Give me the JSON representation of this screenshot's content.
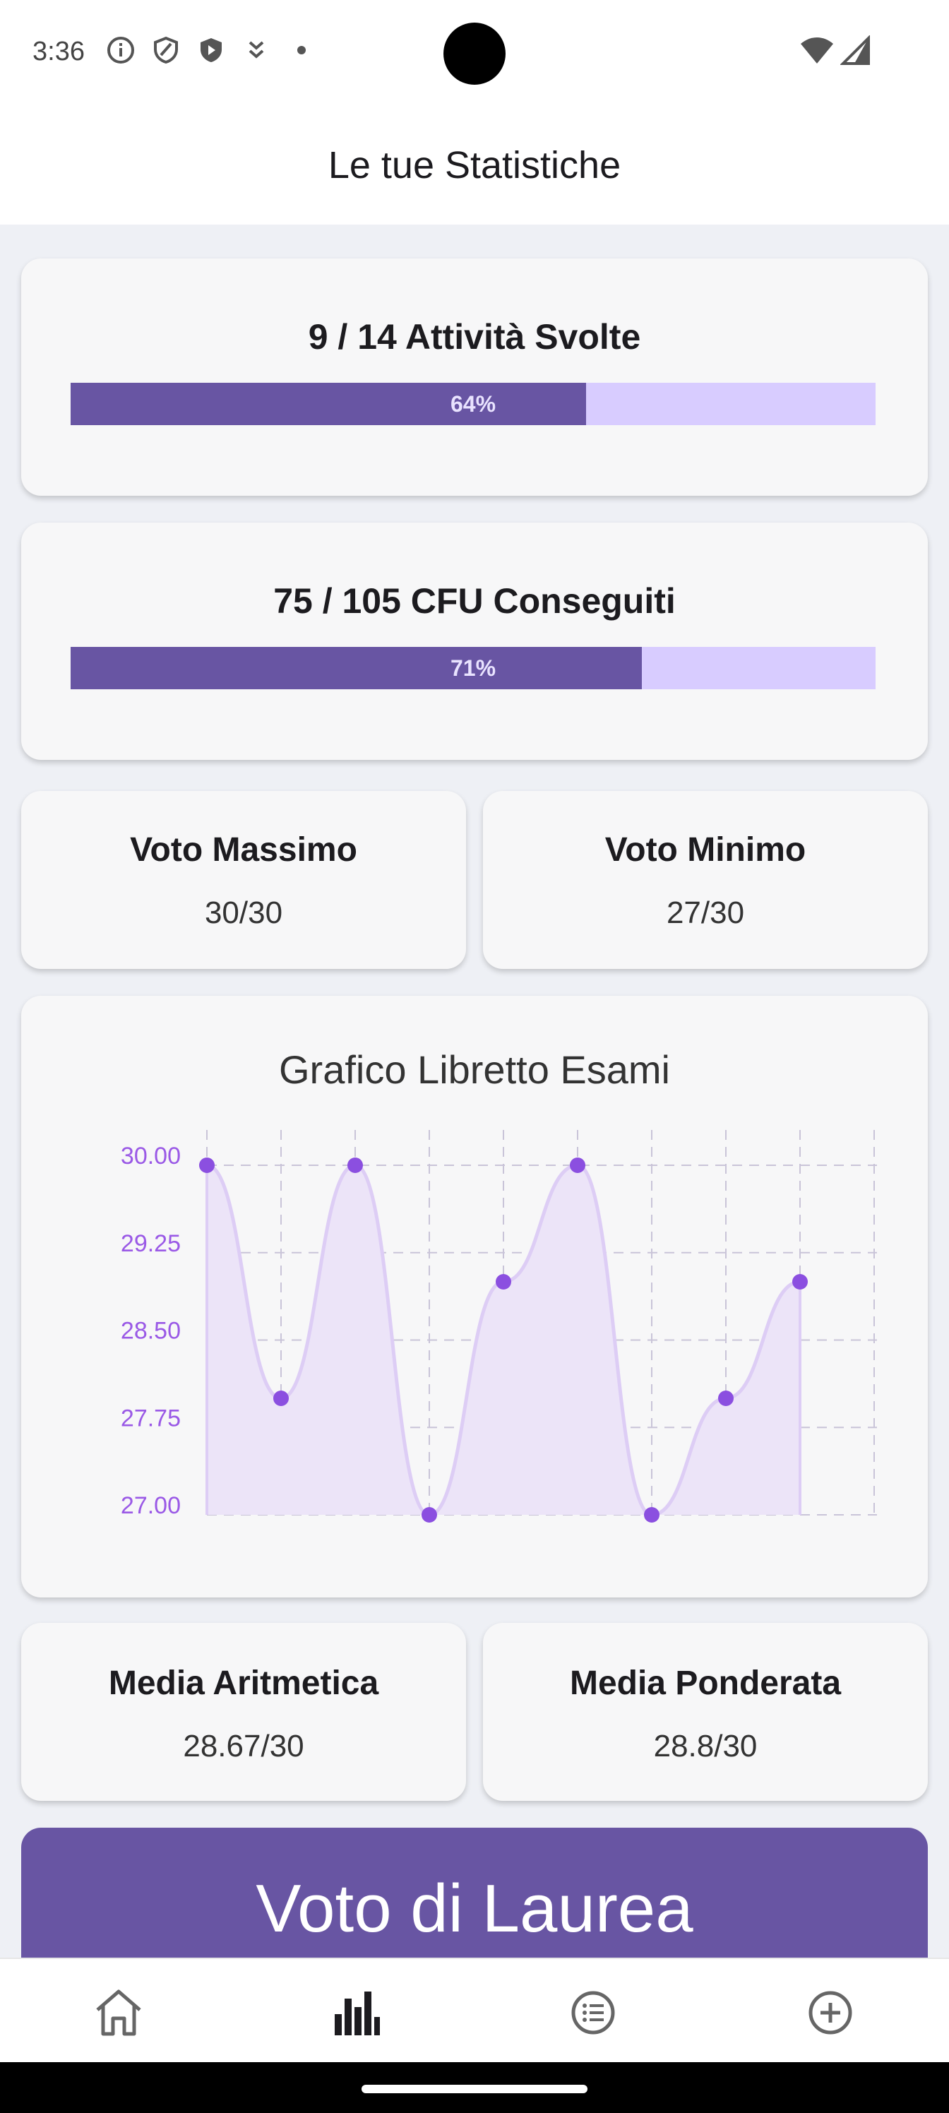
{
  "status_bar": {
    "time": "3:36",
    "icons": [
      "info-icon",
      "shield-icon",
      "shield-play-icon",
      "download-icon",
      "dot-icon"
    ],
    "right_icons": [
      "wifi-icon",
      "signal-icon"
    ]
  },
  "header": {
    "title": "Le tue Statistiche"
  },
  "activities": {
    "title": "9 / 14 Attività Svolte",
    "percent_label": "64%",
    "progress": 0.64
  },
  "cfu": {
    "title": "75 / 105 CFU Conseguiti",
    "percent_label": "71%",
    "progress": 0.71
  },
  "max_grade": {
    "title": "Voto Massimo",
    "value": "30/30"
  },
  "min_grade": {
    "title": "Voto Minimo",
    "value": "27/30"
  },
  "chart": {
    "title": "Grafico Libretto Esami"
  },
  "chart_data": {
    "type": "area",
    "title": "Grafico Libretto Esami",
    "x": [
      1,
      2,
      3,
      4,
      5,
      6,
      7,
      8,
      9
    ],
    "values": [
      30,
      28,
      30,
      27,
      29,
      30,
      27,
      28,
      29
    ],
    "ylim": [
      27,
      30
    ],
    "yticks": [
      "30.00",
      "29.25",
      "28.50",
      "27.75",
      "27.00"
    ],
    "grid": true,
    "line_color": "#ddcdf5",
    "fill_color": "#ece4f8",
    "point_color": "#8b4fe0",
    "tick_color": "#9a59e6"
  },
  "avg_arith": {
    "title": "Media Aritmetica",
    "value": "28.67/30"
  },
  "avg_weighted": {
    "title": "Media Ponderata",
    "value": "28.8/30"
  },
  "laurea": {
    "title": "Voto di Laurea"
  },
  "nav": {
    "items": [
      "home-icon",
      "stats-icon",
      "list-icon",
      "add-icon"
    ],
    "active": "stats-icon"
  },
  "colors": {
    "accent": "#6855a3",
    "track": "#d8ccff"
  }
}
